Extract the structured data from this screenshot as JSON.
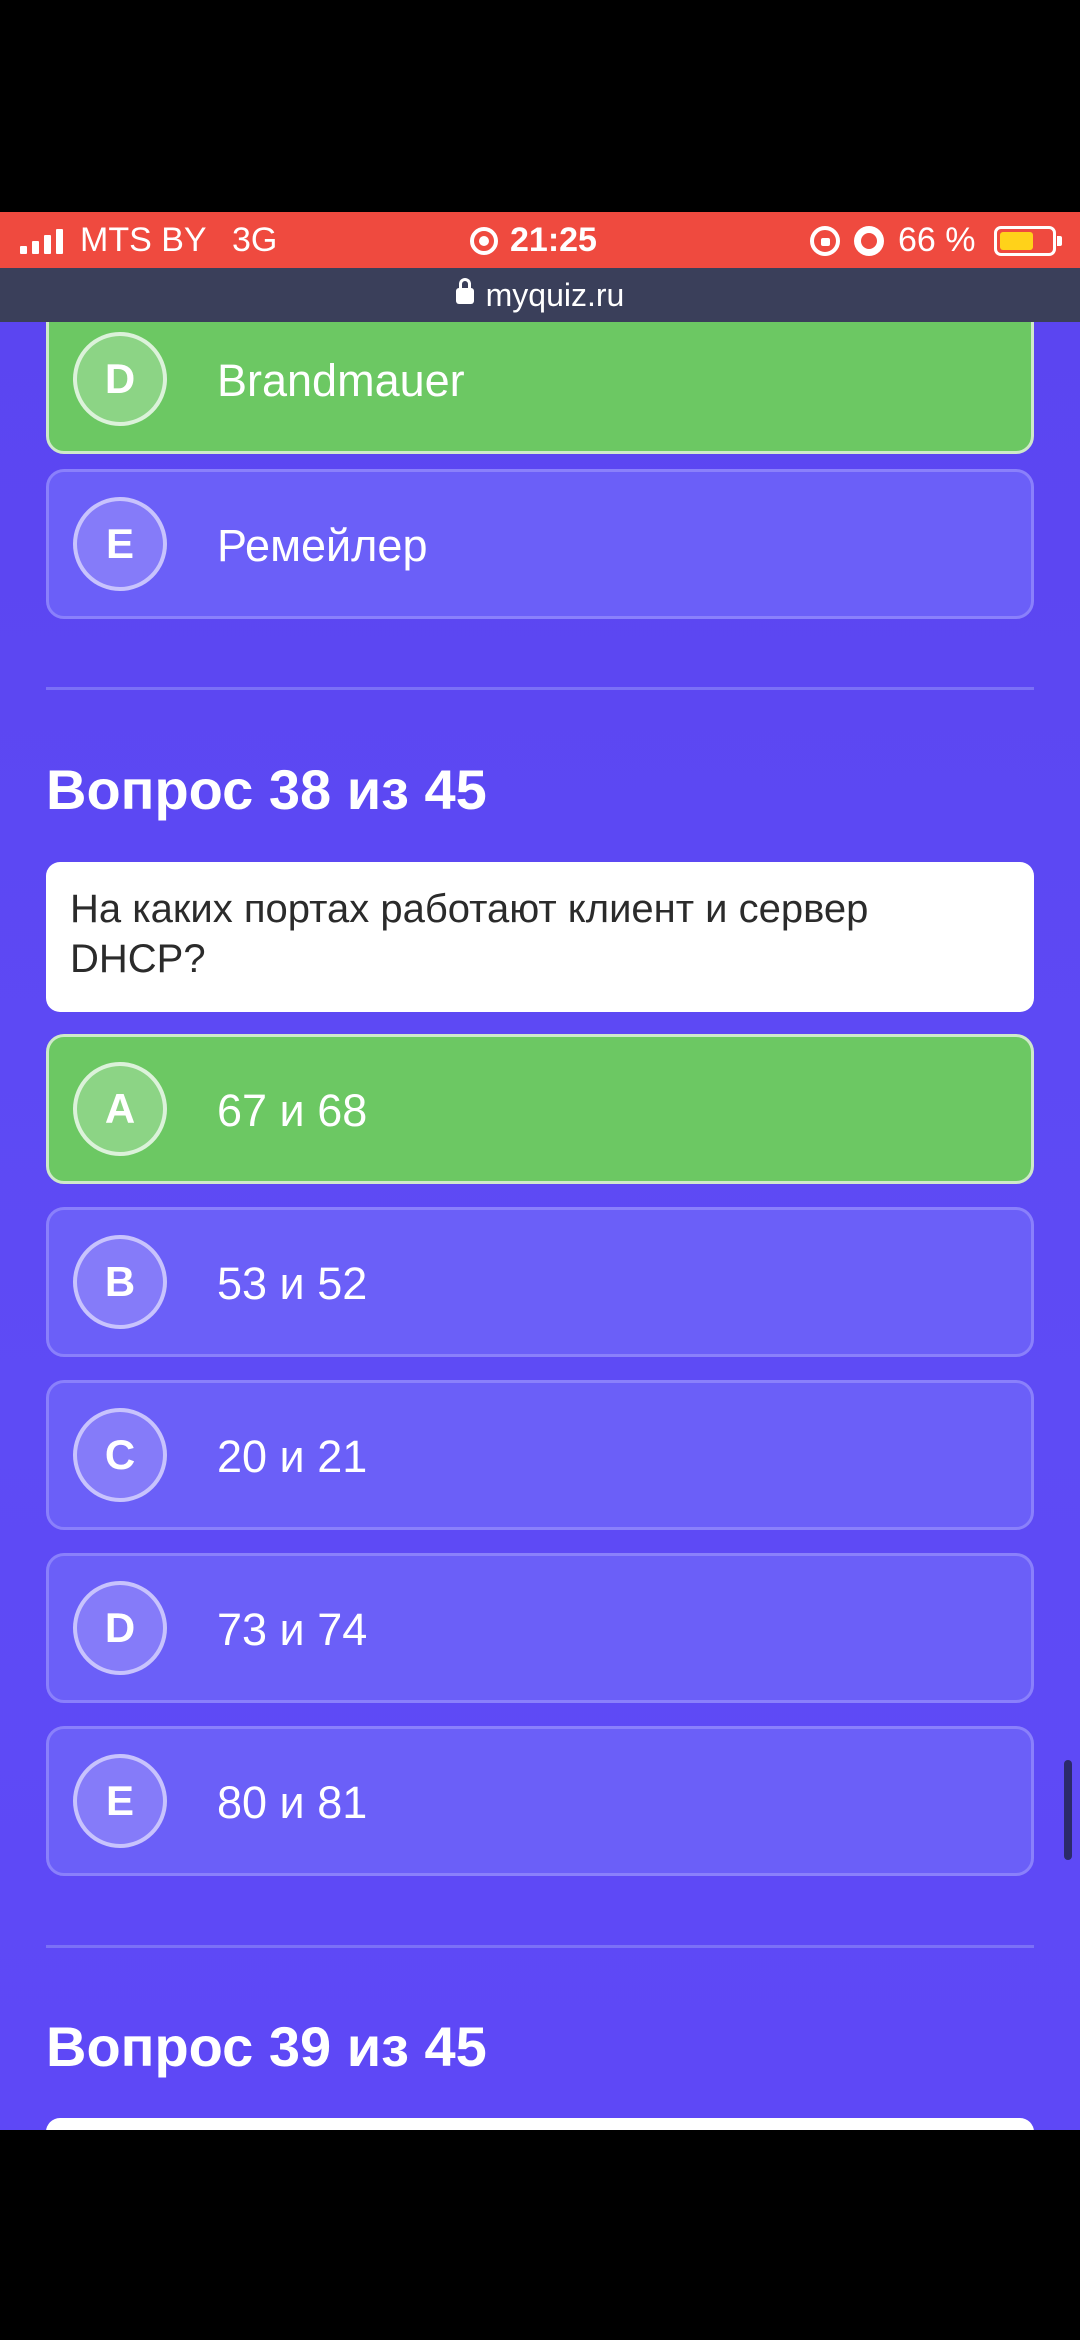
{
  "status_bar": {
    "carrier": "MTS BY",
    "network": "3G",
    "time": "21:25",
    "battery": "66 %",
    "battery_level": 0.66,
    "color": "#ef4a3f"
  },
  "browser": {
    "url": "myquiz.ru"
  },
  "prev_question_options": [
    {
      "letter": "D",
      "text": "Brandmauer",
      "correct": true
    },
    {
      "letter": "E",
      "text": "Ремейлер",
      "correct": false
    }
  ],
  "question_38": {
    "heading": "Вопрос 38 из 45",
    "text": "На каких портах работают клиент и сервер DHCP?",
    "options": [
      {
        "letter": "A",
        "text": "67 и 68",
        "correct": true
      },
      {
        "letter": "B",
        "text": "53 и 52",
        "correct": false
      },
      {
        "letter": "C",
        "text": "20 и 21",
        "correct": false
      },
      {
        "letter": "D",
        "text": "73 и 74",
        "correct": false
      },
      {
        "letter": "E",
        "text": "80 и 81",
        "correct": false
      }
    ]
  },
  "question_39": {
    "heading": "Вопрос 39 из 45"
  },
  "colors": {
    "background": "#5e4bf5",
    "option": "#6b5ff8",
    "correct": "#6cc863"
  }
}
